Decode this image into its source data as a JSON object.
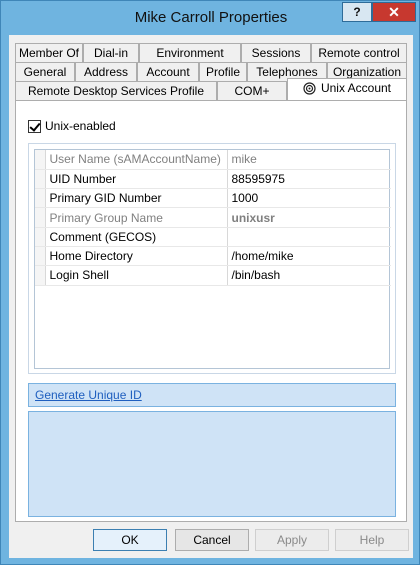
{
  "window": {
    "title": "Mike Carroll Properties",
    "help_label": "?",
    "close_label": "✕"
  },
  "tabs": {
    "row1": [
      "Member Of",
      "Dial-in",
      "Environment",
      "Sessions",
      "Remote control"
    ],
    "row2": [
      "General",
      "Address",
      "Account",
      "Profile",
      "Telephones",
      "Organization"
    ],
    "row3": [
      "Remote Desktop Services Profile",
      "COM+",
      "Unix Account"
    ],
    "active": "Unix Account"
  },
  "unix": {
    "unix_enabled_label": "Unix-enabled",
    "unix_enabled": true,
    "attributes": [
      {
        "name": "User Name (sAMAccountName)",
        "value": "mike",
        "disabled": true
      },
      {
        "name": "UID Number",
        "value": "88595975",
        "disabled": false
      },
      {
        "name": "Primary GID Number",
        "value": "1000",
        "disabled": false
      },
      {
        "name": "Primary Group Name",
        "value": "unixusr",
        "disabled": true
      },
      {
        "name": "Comment (GECOS)",
        "value": "",
        "disabled": false
      },
      {
        "name": "Home Directory",
        "value": "/home/mike",
        "disabled": false
      },
      {
        "name": "Login Shell",
        "value": "/bin/bash",
        "disabled": false
      }
    ],
    "generate_link": "Generate Unique ID"
  },
  "buttons": {
    "ok": "OK",
    "cancel": "Cancel",
    "apply": "Apply",
    "help": "Help"
  },
  "colors": {
    "frame": "#6fb4e0",
    "close": "#c7382f",
    "link": "#1f5fbf"
  }
}
